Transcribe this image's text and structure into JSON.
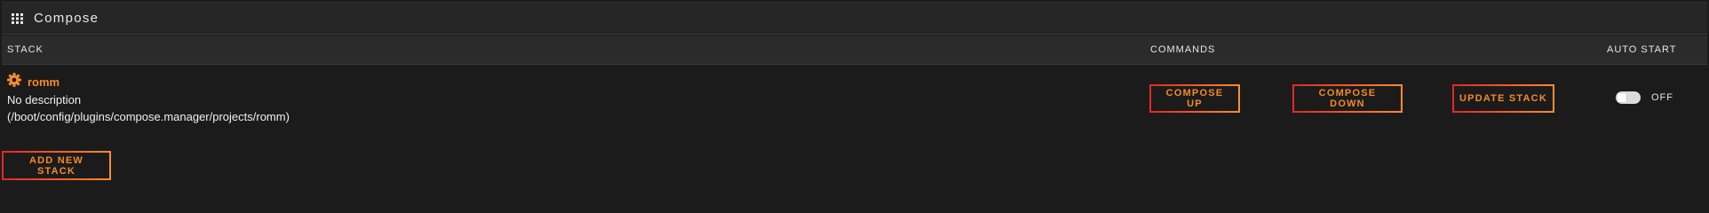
{
  "header": {
    "icon": "apps-grid-icon",
    "title": "Compose"
  },
  "table": {
    "columns": {
      "stack": "STACK",
      "commands": "COMMANDS",
      "auto_start": "AUTO START"
    },
    "rows": [
      {
        "icon": "gear-icon",
        "name": "romm",
        "description": "No description",
        "path": "(/boot/config/plugins/compose.manager/projects/romm)",
        "commands": {
          "compose_up": "COMPOSE UP",
          "compose_down": "COMPOSE DOWN",
          "update_stack": "UPDATE STACK"
        },
        "auto_start": {
          "enabled": false,
          "label": "OFF"
        }
      }
    ]
  },
  "footer": {
    "add_stack_label": "ADD NEW STACK"
  },
  "colors": {
    "background": "#1c1b1b",
    "accent_orange": "#f28a2e",
    "accent_red": "#e22828",
    "header_bg": "#2b2b2b"
  }
}
